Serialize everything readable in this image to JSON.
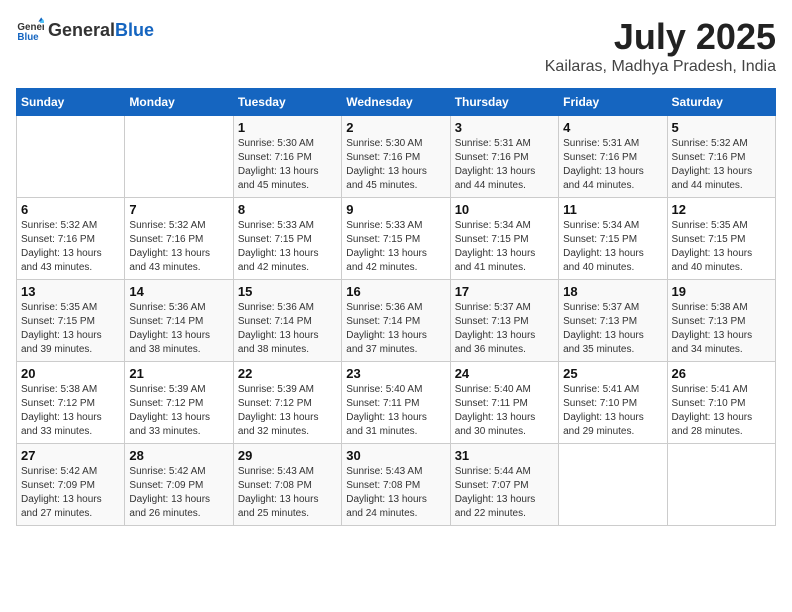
{
  "header": {
    "logo_general": "General",
    "logo_blue": "Blue",
    "month_year": "July 2025",
    "location": "Kailaras, Madhya Pradesh, India"
  },
  "weekdays": [
    "Sunday",
    "Monday",
    "Tuesday",
    "Wednesday",
    "Thursday",
    "Friday",
    "Saturday"
  ],
  "weeks": [
    [
      {
        "day": "",
        "info": ""
      },
      {
        "day": "",
        "info": ""
      },
      {
        "day": "1",
        "info": "Sunrise: 5:30 AM\nSunset: 7:16 PM\nDaylight: 13 hours and 45 minutes."
      },
      {
        "day": "2",
        "info": "Sunrise: 5:30 AM\nSunset: 7:16 PM\nDaylight: 13 hours and 45 minutes."
      },
      {
        "day": "3",
        "info": "Sunrise: 5:31 AM\nSunset: 7:16 PM\nDaylight: 13 hours and 44 minutes."
      },
      {
        "day": "4",
        "info": "Sunrise: 5:31 AM\nSunset: 7:16 PM\nDaylight: 13 hours and 44 minutes."
      },
      {
        "day": "5",
        "info": "Sunrise: 5:32 AM\nSunset: 7:16 PM\nDaylight: 13 hours and 44 minutes."
      }
    ],
    [
      {
        "day": "6",
        "info": "Sunrise: 5:32 AM\nSunset: 7:16 PM\nDaylight: 13 hours and 43 minutes."
      },
      {
        "day": "7",
        "info": "Sunrise: 5:32 AM\nSunset: 7:16 PM\nDaylight: 13 hours and 43 minutes."
      },
      {
        "day": "8",
        "info": "Sunrise: 5:33 AM\nSunset: 7:15 PM\nDaylight: 13 hours and 42 minutes."
      },
      {
        "day": "9",
        "info": "Sunrise: 5:33 AM\nSunset: 7:15 PM\nDaylight: 13 hours and 42 minutes."
      },
      {
        "day": "10",
        "info": "Sunrise: 5:34 AM\nSunset: 7:15 PM\nDaylight: 13 hours and 41 minutes."
      },
      {
        "day": "11",
        "info": "Sunrise: 5:34 AM\nSunset: 7:15 PM\nDaylight: 13 hours and 40 minutes."
      },
      {
        "day": "12",
        "info": "Sunrise: 5:35 AM\nSunset: 7:15 PM\nDaylight: 13 hours and 40 minutes."
      }
    ],
    [
      {
        "day": "13",
        "info": "Sunrise: 5:35 AM\nSunset: 7:15 PM\nDaylight: 13 hours and 39 minutes."
      },
      {
        "day": "14",
        "info": "Sunrise: 5:36 AM\nSunset: 7:14 PM\nDaylight: 13 hours and 38 minutes."
      },
      {
        "day": "15",
        "info": "Sunrise: 5:36 AM\nSunset: 7:14 PM\nDaylight: 13 hours and 38 minutes."
      },
      {
        "day": "16",
        "info": "Sunrise: 5:36 AM\nSunset: 7:14 PM\nDaylight: 13 hours and 37 minutes."
      },
      {
        "day": "17",
        "info": "Sunrise: 5:37 AM\nSunset: 7:13 PM\nDaylight: 13 hours and 36 minutes."
      },
      {
        "day": "18",
        "info": "Sunrise: 5:37 AM\nSunset: 7:13 PM\nDaylight: 13 hours and 35 minutes."
      },
      {
        "day": "19",
        "info": "Sunrise: 5:38 AM\nSunset: 7:13 PM\nDaylight: 13 hours and 34 minutes."
      }
    ],
    [
      {
        "day": "20",
        "info": "Sunrise: 5:38 AM\nSunset: 7:12 PM\nDaylight: 13 hours and 33 minutes."
      },
      {
        "day": "21",
        "info": "Sunrise: 5:39 AM\nSunset: 7:12 PM\nDaylight: 13 hours and 33 minutes."
      },
      {
        "day": "22",
        "info": "Sunrise: 5:39 AM\nSunset: 7:12 PM\nDaylight: 13 hours and 32 minutes."
      },
      {
        "day": "23",
        "info": "Sunrise: 5:40 AM\nSunset: 7:11 PM\nDaylight: 13 hours and 31 minutes."
      },
      {
        "day": "24",
        "info": "Sunrise: 5:40 AM\nSunset: 7:11 PM\nDaylight: 13 hours and 30 minutes."
      },
      {
        "day": "25",
        "info": "Sunrise: 5:41 AM\nSunset: 7:10 PM\nDaylight: 13 hours and 29 minutes."
      },
      {
        "day": "26",
        "info": "Sunrise: 5:41 AM\nSunset: 7:10 PM\nDaylight: 13 hours and 28 minutes."
      }
    ],
    [
      {
        "day": "27",
        "info": "Sunrise: 5:42 AM\nSunset: 7:09 PM\nDaylight: 13 hours and 27 minutes."
      },
      {
        "day": "28",
        "info": "Sunrise: 5:42 AM\nSunset: 7:09 PM\nDaylight: 13 hours and 26 minutes."
      },
      {
        "day": "29",
        "info": "Sunrise: 5:43 AM\nSunset: 7:08 PM\nDaylight: 13 hours and 25 minutes."
      },
      {
        "day": "30",
        "info": "Sunrise: 5:43 AM\nSunset: 7:08 PM\nDaylight: 13 hours and 24 minutes."
      },
      {
        "day": "31",
        "info": "Sunrise: 5:44 AM\nSunset: 7:07 PM\nDaylight: 13 hours and 22 minutes."
      },
      {
        "day": "",
        "info": ""
      },
      {
        "day": "",
        "info": ""
      }
    ]
  ]
}
